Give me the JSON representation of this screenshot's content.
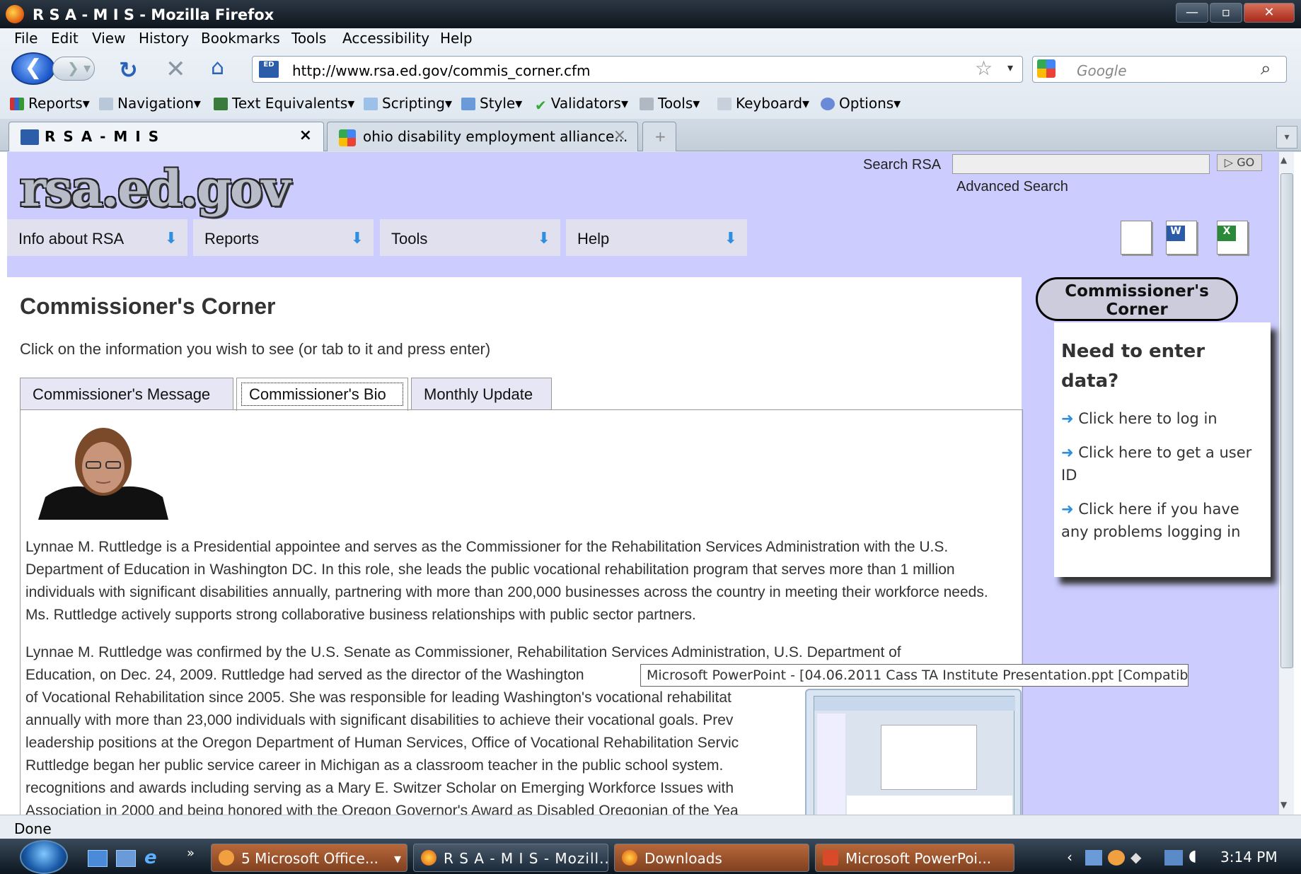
{
  "window": {
    "title": "R S A - M I S - Mozilla Firefox",
    "controls": [
      "—",
      "▫",
      "✕"
    ]
  },
  "menubar": [
    {
      "label": "File"
    },
    {
      "label": "Edit"
    },
    {
      "label": "View"
    },
    {
      "label": "History"
    },
    {
      "label": "Bookmarks"
    },
    {
      "label": "Tools"
    },
    {
      "label": "Accessibility"
    },
    {
      "label": "Help"
    }
  ],
  "nav": {
    "url": "http://www.rsa.ed.gov/commis_corner.cfm",
    "search_placeholder": "Google",
    "url_icon": "ED"
  },
  "devtoolbar": [
    "Reports",
    "Navigation",
    "Text Equivalents",
    "Scripting",
    "Style",
    "Validators",
    "Tools",
    "Keyboard",
    "Options"
  ],
  "browser_tabs": [
    {
      "label": "R S A - M I S",
      "active": true
    },
    {
      "label": "ohio disability employment alliance...",
      "active": false
    }
  ],
  "site": {
    "logo": "rsa.ed.gov",
    "search_label": "Search RSA",
    "go": "GO",
    "advanced": "Advanced Search",
    "nav": [
      "Info about RSA",
      "Reports",
      "Tools",
      "Help"
    ],
    "doc_icons": [
      "text-doc-icon",
      "word-doc-icon",
      "excel-doc-icon"
    ]
  },
  "main": {
    "title": "Commissioner's Corner",
    "instructions": "Click on the information you wish to see (or tab to it and press enter)",
    "tabs": [
      "Commissioner's Message",
      "Commissioner's Bio",
      "Monthly Update"
    ],
    "active_tab": "Commissioner's Bio",
    "para1": "Lynnae M. Ruttledge is a Presidential appointee and serves as the Commissioner for the Rehabilitation Services Administration with the U.S. Department of Education in Washington DC. In this role, she leads the public vocational rehabilitation program that serves more than 1 million individuals with significant disabilities annually, partnering with more than 200,000 businesses across the country in meeting their workforce needs. Ms. Ruttledge actively supports strong collaborative business relationships with public sector partners.",
    "para2_lines": [
      "Lynnae M. Ruttledge was confirmed by the U.S. Senate as Commissioner, Rehabilitation Services Administration, U.S. Department of",
      "Education, on Dec. 24, 2009. Ruttledge had served as the director of the Washington",
      "of Vocational Rehabilitation since 2005. She was responsible for leading Washington's vocational rehabilitat",
      "annually with more than 23,000 individuals with significant disabilities to achieve their vocational goals. Prev",
      "leadership positions at the Oregon Department of Human Services, Office of Vocational Rehabilitation Servic",
      "Ruttledge began her public service career in Michigan as a classroom teacher in the public school system.",
      "recognitions and awards including serving as a Mary E. Switzer Scholar on Emerging Workforce Issues with",
      "Association in 2000 and being honored with the Oregon Governor's Award as Disabled Oregonian of the Yea"
    ]
  },
  "sidebar": {
    "badge": "Commissioner's Corner",
    "heading": "Need to enter data?",
    "links": [
      "Click here to log in",
      "Click here to get a user ID",
      "Click here if you have any problems logging in"
    ]
  },
  "tooltip": "Microsoft PowerPoint - [04.06.2011 Cass TA Institute Presentation.ppt [Compatib",
  "status": "Done",
  "taskbar": {
    "buttons": [
      "5 Microsoft Office...",
      "R S A - M I S - Mozill...",
      "Downloads",
      "Microsoft PowerPoi..."
    ],
    "clock": "3:14 PM"
  },
  "colors": {
    "page_bg": "#ccccff",
    "link_arrow": "#2e8fe0"
  }
}
